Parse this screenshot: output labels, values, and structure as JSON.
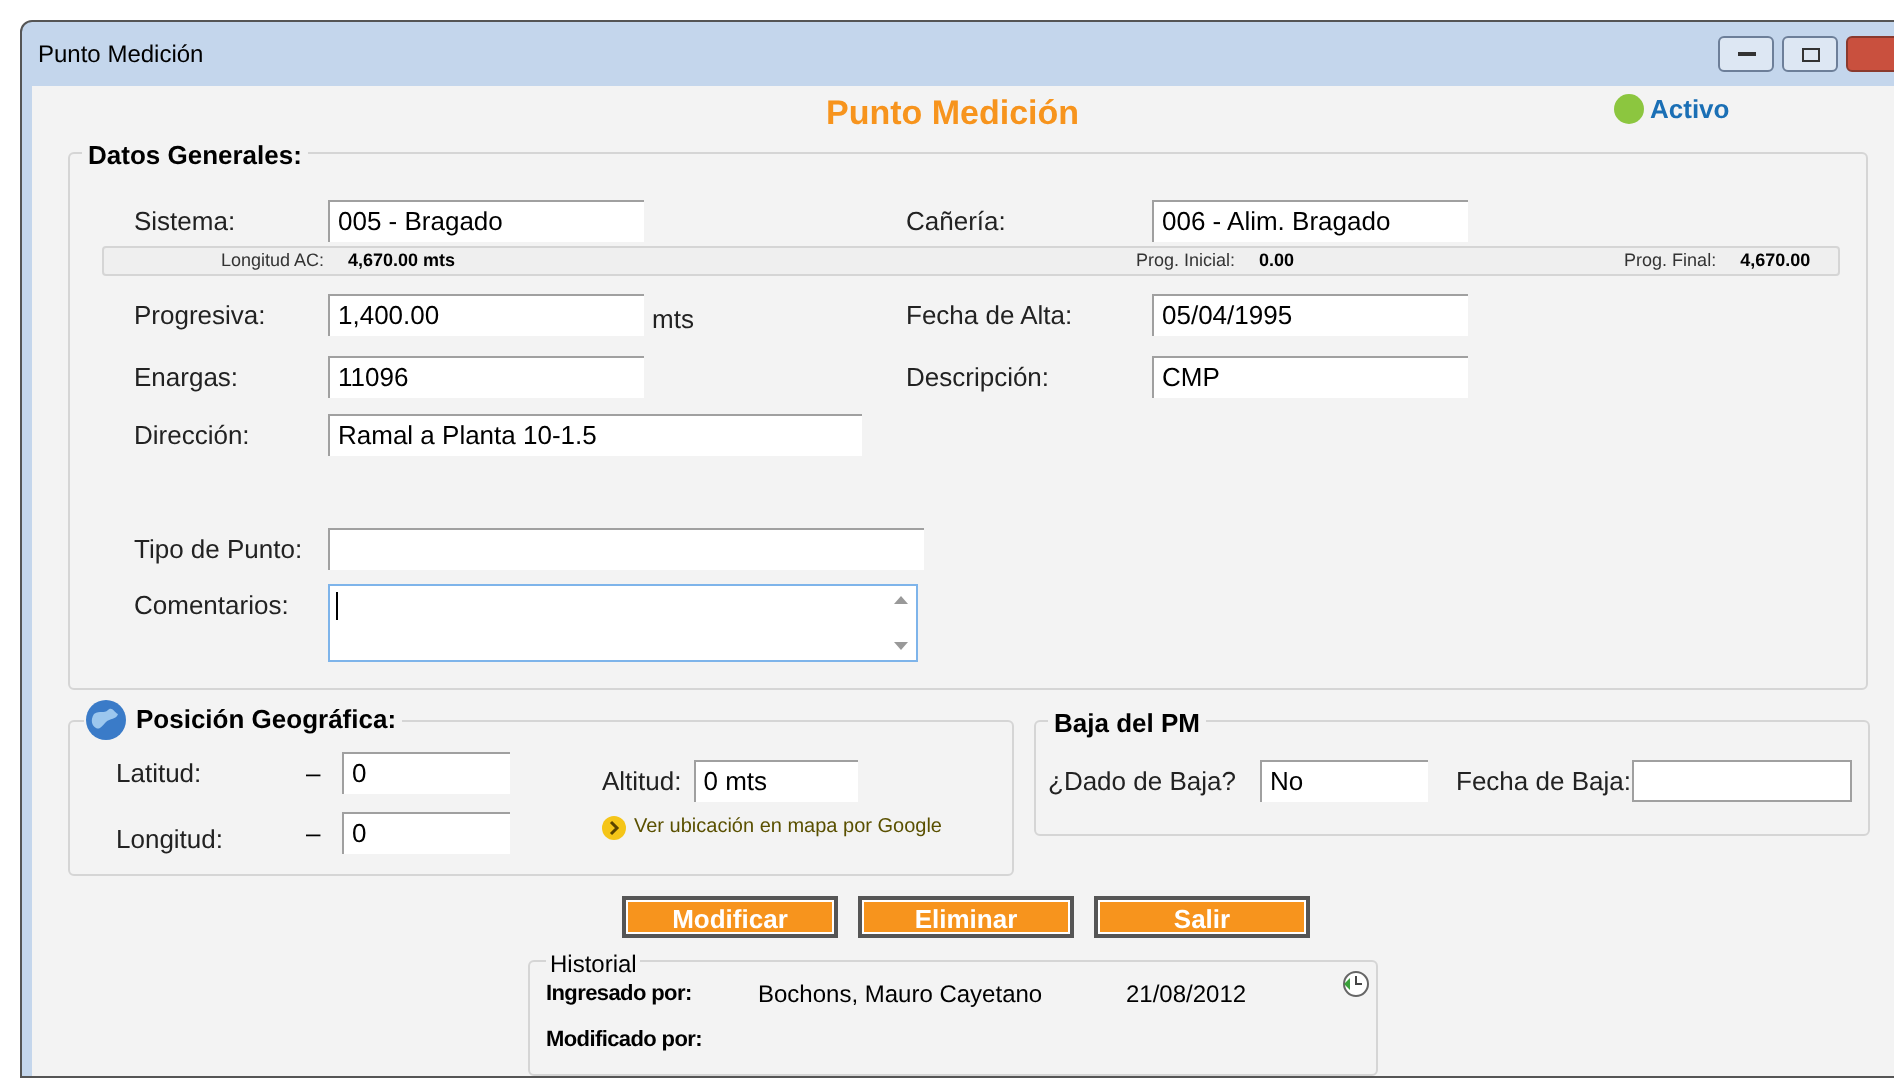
{
  "window": {
    "title": "Punto Medición"
  },
  "header": {
    "title": "Punto Medición",
    "status": "Activo",
    "active": true
  },
  "datos_generales": {
    "legend": "Datos Generales:",
    "sistema": {
      "label": "Sistema:",
      "value": "005 - Bragado"
    },
    "caneria": {
      "label": "Cañería:",
      "value": "006 - Alim. Bragado"
    },
    "strip": [
      {
        "label": "Longitud AC:",
        "value": "4,670.00 mts"
      },
      {
        "label": "Prog. Inicial:",
        "value": "0.00"
      },
      {
        "label": "Prog. Final:",
        "value": "4,670.00"
      }
    ],
    "progresiva": {
      "label": "Progresiva:",
      "value": "1,400.00",
      "unit": "mts"
    },
    "fecha_alta": {
      "label": "Fecha de Alta:",
      "value": "05/04/1995"
    },
    "enargas": {
      "label": "Enargas:",
      "value": "11096"
    },
    "descripcion": {
      "label": "Descripción:",
      "value": "CMP"
    },
    "direccion": {
      "label": "Dirección:",
      "value": "Ramal a Planta 10-1.5"
    },
    "tipo_punto": {
      "label": "Tipo de Punto:"
    },
    "comentarios": {
      "label": "Comentarios:"
    }
  },
  "posicion": {
    "legend": "Posición Geográfica:",
    "latitud": {
      "label": "Latitud:",
      "sign": "–",
      "value": "0"
    },
    "longitud": {
      "label": "Longitud:",
      "sign": "–",
      "value": "0"
    },
    "altitud": {
      "label": "Altitud:",
      "value": "0 mts"
    },
    "map_link": "Ver ubicación en mapa por Google"
  },
  "baja": {
    "legend": "Baja del PM",
    "dado": {
      "label": "¿Dado de Baja?",
      "value": "No"
    },
    "fecha": {
      "label": "Fecha de Baja:"
    }
  },
  "buttons": [
    "Modificar",
    "Eliminar",
    "Salir"
  ],
  "historial": {
    "legend": "Historial",
    "ingresado": {
      "label": "Ingresado por:",
      "user": "Bochons, Mauro Cayetano",
      "date": "21/08/2012"
    },
    "modificado": {
      "label": "Modificado por:"
    }
  }
}
